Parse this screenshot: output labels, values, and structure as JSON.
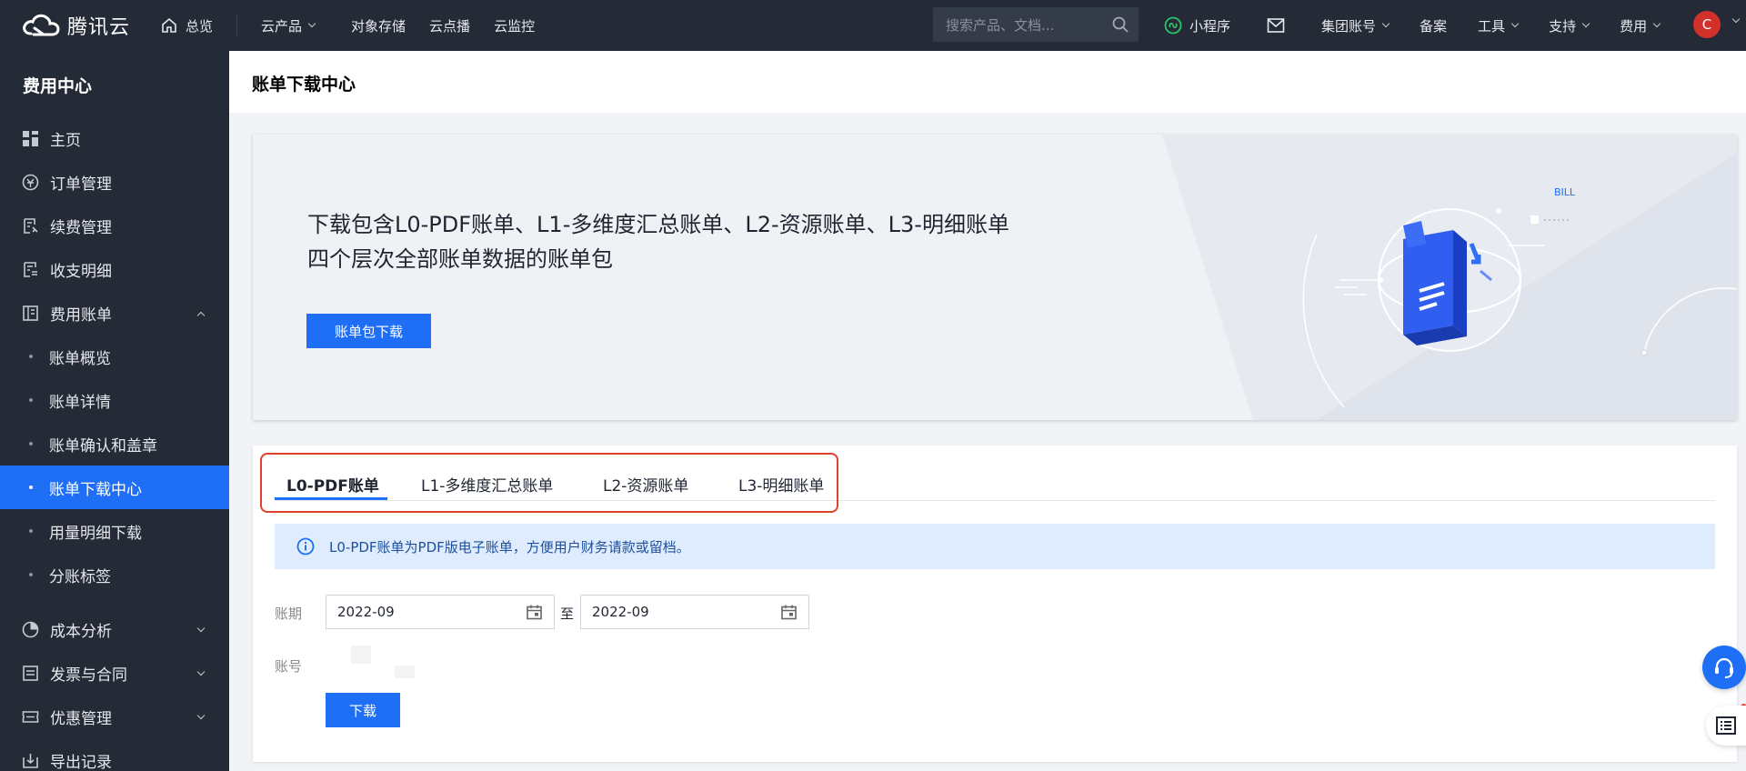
{
  "topbar": {
    "brand": "腾讯云",
    "home": "总览",
    "nav": [
      {
        "label": "云产品",
        "dropdown": true
      },
      {
        "label": "对象存储"
      },
      {
        "label": "云点播"
      },
      {
        "label": "云监控"
      }
    ],
    "search_placeholder": "搜索产品、文档...",
    "mini_program": "小程序",
    "right": [
      {
        "label": "集团账号",
        "dropdown": true
      },
      {
        "label": "备案"
      },
      {
        "label": "工具",
        "dropdown": true
      },
      {
        "label": "支持",
        "dropdown": true
      },
      {
        "label": "费用",
        "dropdown": true
      }
    ],
    "avatar": "C"
  },
  "sidebar": {
    "title": "费用中心",
    "items": [
      {
        "label": "主页",
        "icon": "dashboard-icon"
      },
      {
        "label": "订单管理",
        "icon": "order-icon"
      },
      {
        "label": "续费管理",
        "icon": "renew-icon"
      },
      {
        "label": "收支明细",
        "icon": "ledger-icon"
      },
      {
        "label": "费用账单",
        "icon": "bill-icon",
        "expanded": true
      }
    ],
    "subitems": [
      {
        "label": "账单概览"
      },
      {
        "label": "账单详情"
      },
      {
        "label": "账单确认和盖章"
      },
      {
        "label": "账单下载中心",
        "active": true
      },
      {
        "label": "用量明细下载"
      },
      {
        "label": "分账标签"
      }
    ],
    "items_after": [
      {
        "label": "成本分析",
        "icon": "pie-icon"
      },
      {
        "label": "发票与合同",
        "icon": "invoice-icon"
      },
      {
        "label": "优惠管理",
        "icon": "ticket-icon"
      },
      {
        "label": "导出记录",
        "icon": "export-icon"
      }
    ]
  },
  "page": {
    "title": "账单下载中心"
  },
  "banner": {
    "line1": "下载包含L0-PDF账单、L1-多维度汇总账单、L2-资源账单、L3-明细账单",
    "line2": "四个层次全部账单数据的账单包",
    "button": "账单包下载",
    "art_label": "BILL"
  },
  "tabs": [
    {
      "label": "L0-PDF账单",
      "active": true
    },
    {
      "label": "L1-多维度汇总账单"
    },
    {
      "label": "L2-资源账单"
    },
    {
      "label": "L3-明细账单"
    }
  ],
  "info": "L0-PDF账单为PDF版电子账单，方便用户财务请款或留档。",
  "form": {
    "period_label": "账期",
    "start": "2022-09",
    "to": "至",
    "end": "2022-09",
    "account_label": "账号",
    "download": "下载"
  }
}
